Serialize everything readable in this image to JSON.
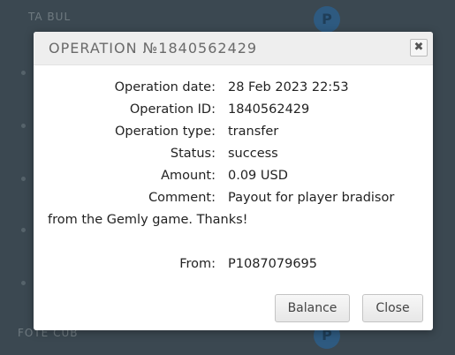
{
  "background": {
    "rows": [
      {
        "label": "TA BUL"
      },
      {
        "label": "FOTE CUB"
      }
    ],
    "badge_letter": "P"
  },
  "dialog": {
    "title": "OPERATION №1840562429",
    "close_symbol": "✖",
    "fields": {
      "date_label": "Operation date:",
      "date_value": "28 Feb 2023 22:53",
      "id_label": "Operation ID:",
      "id_value": "1840562429",
      "type_label": "Operation type:",
      "type_value": "transfer",
      "status_label": "Status:",
      "status_value": "success",
      "amount_label": "Amount:",
      "amount_value": "0.09 USD",
      "comment_label": "Comment:",
      "comment_line1": "Payout for player bradisor",
      "comment_line2": "from the Gemly game. Thanks!",
      "from_label": "From:",
      "from_value": "P1087079695"
    },
    "buttons": {
      "balance": "Balance",
      "close": "Close"
    }
  }
}
